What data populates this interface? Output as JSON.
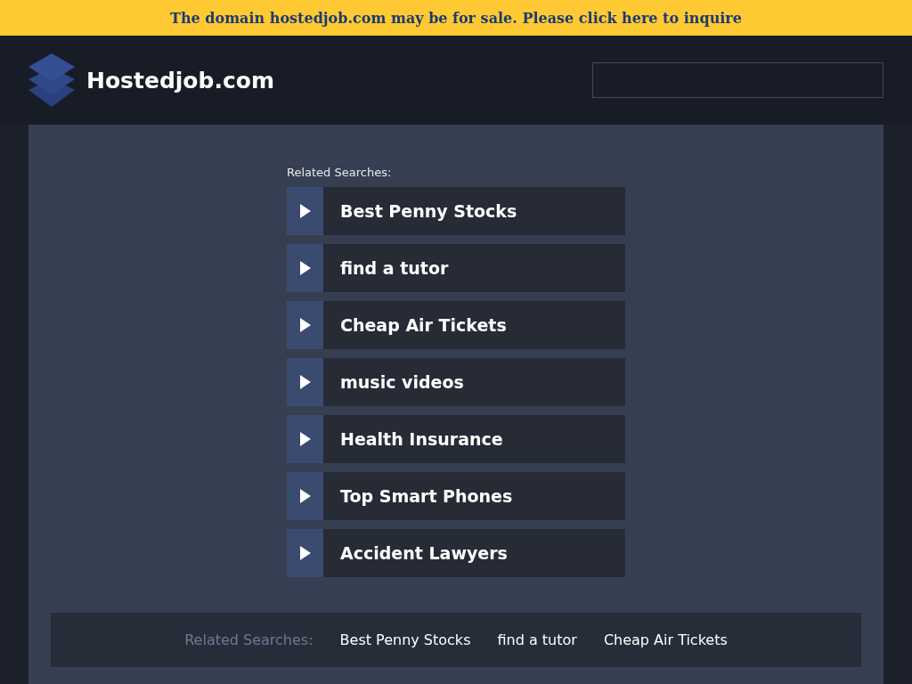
{
  "banner": {
    "text": "The domain hostedjob.com may be for sale. Please click here to inquire"
  },
  "header": {
    "site_name": "Hostedjob.com"
  },
  "related": {
    "heading": "Related Searches:",
    "links": [
      "Best Penny Stocks",
      "find a tutor",
      "Cheap Air Tickets",
      "music videos",
      "Health Insurance",
      "Top Smart Phones",
      "Accident Lawyers"
    ]
  },
  "footer": {
    "heading": "Related Searches:",
    "links": [
      "Best Penny Stocks",
      "find a tutor",
      "Cheap Air Tickets"
    ]
  }
}
